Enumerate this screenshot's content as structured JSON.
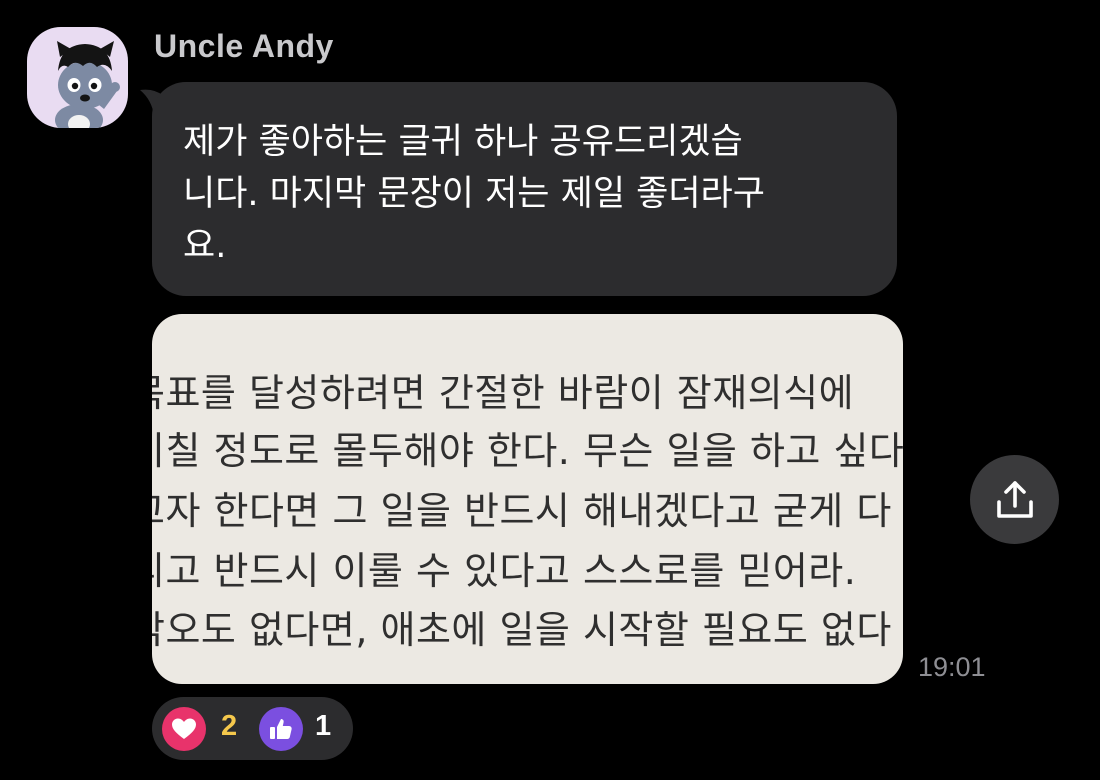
{
  "message": {
    "sender_name": "Uncle Andy",
    "text_lines": [
      "제가 좋아하는 글귀 하나  공유드리겠습",
      "니다. 마지막 문장이 저는 제일 좋더라구",
      "요."
    ],
    "timestamp": "19:01"
  },
  "photo": {
    "lines": [
      "목표를 달성하려면 간절한 바람이 잠재의식에 ",
      "미칠 정도로 몰두해야 한다. 무슨 일을 하고 싶다",
      "고자 한다면 그 일을 반드시 해내겠다고 굳게 다",
      "리고 반드시 이룰 수 있다고 스스로를 믿어라. ",
      "각오도 없다면, 애초에 일을 시작할 필요도 없다"
    ]
  },
  "reactions": [
    {
      "icon": "heart-icon",
      "count": "2",
      "bg_color": "#e8336b",
      "count_color": "#f5c84c"
    },
    {
      "icon": "thumbs-up-icon",
      "count": "1",
      "bg_color": "#7b4fe0",
      "count_color": "#ffffff"
    }
  ],
  "actions": {
    "share_icon": "share-icon"
  },
  "colors": {
    "background": "#000000",
    "bubble": "#2c2c2e",
    "sender_text": "#c9c9cc",
    "timestamp_text": "#8e8e93",
    "photo_paper": "#ece9e3"
  }
}
